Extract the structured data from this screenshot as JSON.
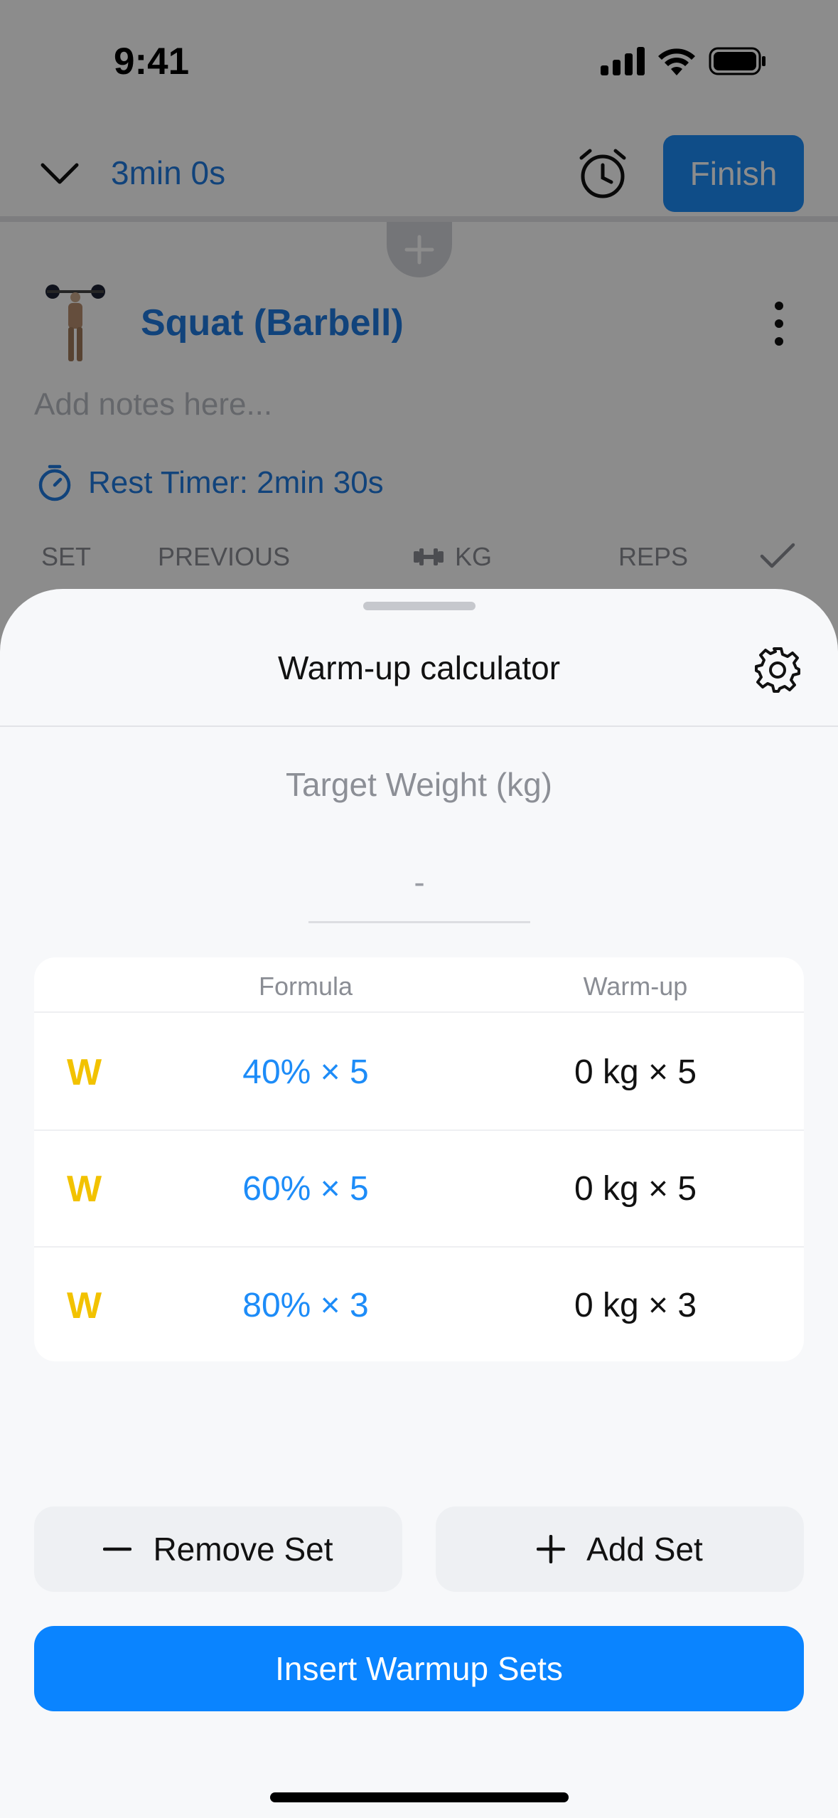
{
  "status_bar": {
    "time": "9:41"
  },
  "workout_header": {
    "elapsed": "3min 0s",
    "finish_label": "Finish"
  },
  "exercise": {
    "name": "Squat (Barbell)",
    "notes_placeholder": "Add notes here...",
    "rest_timer": "Rest Timer: 2min 30s",
    "columns": [
      "SET",
      "PREVIOUS",
      "KG",
      "REPS"
    ]
  },
  "sheet": {
    "title": "Warm-up calculator",
    "target_label": "Target Weight (kg)",
    "target_value": "-",
    "table_headers": {
      "formula": "Formula",
      "warmup": "Warm-up"
    },
    "rows": [
      {
        "type": "W",
        "formula": "40% × 5",
        "warmup": "0 kg × 5"
      },
      {
        "type": "W",
        "formula": "60% × 5",
        "warmup": "0 kg × 5"
      },
      {
        "type": "W",
        "formula": "80% × 3",
        "warmup": "0 kg × 3"
      }
    ],
    "remove_label": "Remove Set",
    "add_label": "Add Set",
    "insert_label": "Insert Warmup Sets"
  },
  "colors": {
    "accent": "#0a84ff",
    "warmup_marker": "#f2c200",
    "link": "#1f7ae0"
  },
  "icons": [
    "chevron-down-icon",
    "alarm-clock-icon",
    "plus-icon",
    "more-vertical-icon",
    "stopwatch-icon",
    "dumbbell-icon",
    "checkmark-icon",
    "gear-icon",
    "minus-icon"
  ]
}
